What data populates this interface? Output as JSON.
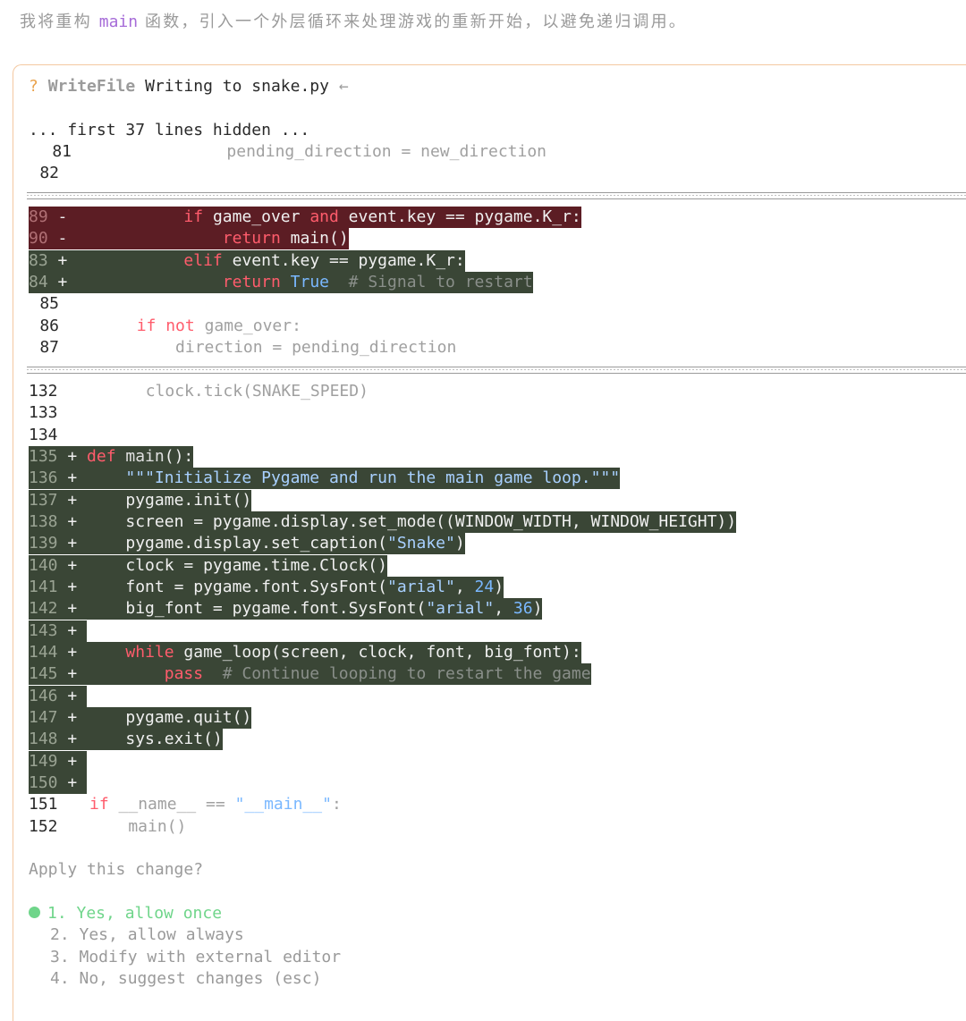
{
  "intro": {
    "before": "我将重构 ",
    "code": "main",
    "after": " 函数，引入一个外层循环来处理游戏的重新开始，以避免递归调用。"
  },
  "tool": {
    "status_icon": "?",
    "name": "WriteFile",
    "description": "Writing to snake.py",
    "arrow": "←"
  },
  "diff": {
    "hidden_note": "... first 37 lines hidden ...",
    "ctx1": [
      {
        "num": "81",
        "code": "                pending_direction = new_direction"
      },
      {
        "num": "82",
        "code": ""
      }
    ],
    "hunk2": {
      "del89": {
        "num": "89",
        "sign": "-",
        "indent": "            ",
        "k1": "if",
        "t1": " game_over ",
        "k2": "and",
        "t2": " event.key == pygame.K_r:"
      },
      "del90": {
        "num": "90",
        "sign": "-",
        "indent": "                ",
        "k1": "return",
        "t1": " main()"
      },
      "add83": {
        "num": "83",
        "sign": "+",
        "indent": "            ",
        "k1": "elif",
        "t1": " event.key == pygame.K_r:"
      },
      "add84": {
        "num": "84",
        "sign": "+",
        "indent": "                ",
        "k1": "return",
        "kb": "True",
        "cm": "  # Signal to restart"
      },
      "c85": {
        "num": "85",
        "code": ""
      },
      "c86": {
        "num": "86",
        "indent": "        ",
        "k1": "if not",
        "t1": " game_over:"
      },
      "c87": {
        "num": "87",
        "code": "            direction = pending_direction"
      }
    },
    "hunk3": {
      "c132": {
        "num": "132",
        "code": "        clock.tick(SNAKE_SPEED)"
      },
      "c133": {
        "num": "133",
        "code": ""
      },
      "c134": {
        "num": "134",
        "code": ""
      },
      "a135": {
        "num": "135",
        "k": "def",
        "f": " main",
        "t": "():"
      },
      "a136": {
        "num": "136",
        "indent": "    ",
        "s": "\"\"\"Initialize Pygame and run the main game loop.\"\"\""
      },
      "a137": {
        "num": "137",
        "t": "    pygame.init()"
      },
      "a138": {
        "num": "138",
        "t": "    screen = pygame.display.set_mode((WINDOW_WIDTH, WINDOW_HEIGHT))"
      },
      "a139": {
        "num": "139",
        "t1": "    pygame.display.set_caption(",
        "s": "\"Snake\"",
        "t2": ")"
      },
      "a140": {
        "num": "140",
        "t": "    clock = pygame.time.Clock()"
      },
      "a141": {
        "num": "141",
        "t1": "    font = pygame.font.SysFont(",
        "s": "\"arial\"",
        "t2": ", ",
        "n": "24",
        "t3": ")"
      },
      "a142": {
        "num": "142",
        "t1": "    big_font = pygame.font.SysFont(",
        "s": "\"arial\"",
        "t2": ", ",
        "n": "36",
        "t3": ")"
      },
      "a143": {
        "num": "143"
      },
      "a144": {
        "num": "144",
        "indent": "    ",
        "k": "while",
        "t": " game_loop(screen, clock, font, big_font):"
      },
      "a145": {
        "num": "145",
        "indent": "        ",
        "k": "pass",
        "cm": "  # Continue looping to restart the game"
      },
      "a146": {
        "num": "146"
      },
      "a147": {
        "num": "147",
        "t": "    pygame.quit()"
      },
      "a148": {
        "num": "148",
        "t": "    sys.exit()"
      },
      "a149": {
        "num": "149"
      },
      "a150": {
        "num": "150"
      },
      "c151": {
        "num": "151",
        "k": "if",
        "t1": " __name__ == ",
        "s": "\"__main__\"",
        "t2": ":"
      },
      "c152": {
        "num": "152",
        "code": "    main()"
      }
    }
  },
  "prompt": {
    "question": "Apply this change?",
    "options": [
      "1. Yes, allow once",
      "2. Yes, allow always",
      "3. Modify with external editor",
      "4. No, suggest changes (esc)"
    ]
  },
  "colors": {
    "deleted_bg": "#5c1d24",
    "added_bg": "#3a4636",
    "selected": "#6fd58a",
    "border": "#f4c8a0"
  }
}
